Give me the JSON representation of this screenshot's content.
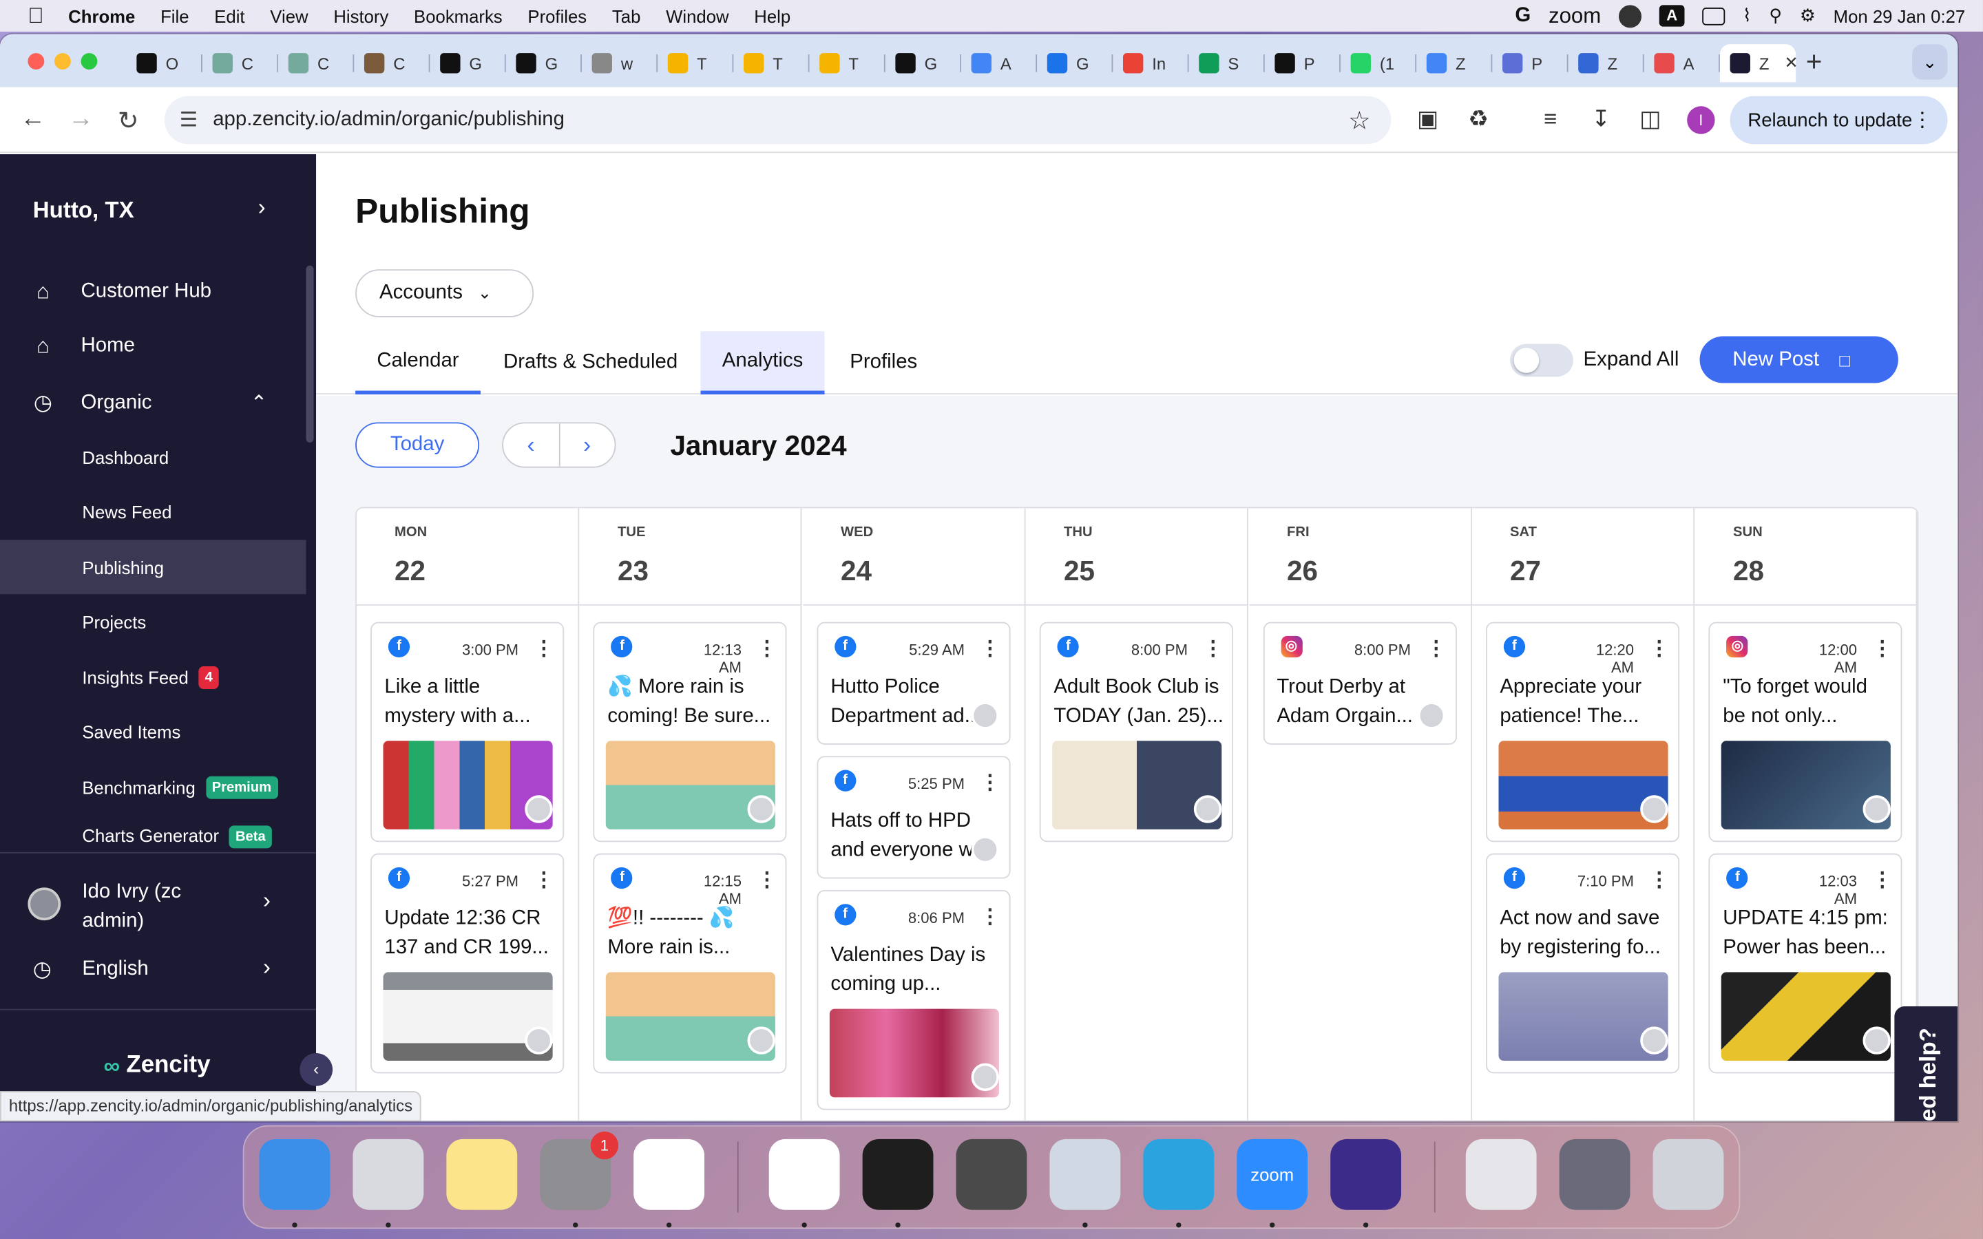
{
  "menubar": {
    "app": "Chrome",
    "items": [
      "File",
      "Edit",
      "View",
      "History",
      "Bookmarks",
      "Profiles",
      "Tab",
      "Window",
      "Help"
    ],
    "zoom_label": "zoom",
    "datetime": "Mon 29 Jan  0:27"
  },
  "browser": {
    "tabs": [
      {
        "letter": "O",
        "color": "#111"
      },
      {
        "letter": "C",
        "color": "#74aa9c"
      },
      {
        "letter": "C",
        "color": "#74aa9c"
      },
      {
        "letter": "C",
        "color": "#7a5a3a"
      },
      {
        "letter": "G",
        "color": "#111"
      },
      {
        "letter": "G",
        "color": "#111"
      },
      {
        "letter": "w",
        "color": "#888"
      },
      {
        "letter": "T",
        "color": "#f4b400"
      },
      {
        "letter": "T",
        "color": "#f4b400"
      },
      {
        "letter": "T",
        "color": "#f4b400"
      },
      {
        "letter": "G",
        "color": "#111"
      },
      {
        "letter": "A",
        "color": "#4285f4"
      },
      {
        "letter": "G",
        "color": "#1a73e8"
      },
      {
        "letter": "In",
        "color": "#ea4335"
      },
      {
        "letter": "S",
        "color": "#0f9d58"
      },
      {
        "letter": "P",
        "color": "#111"
      },
      {
        "letter": "(1",
        "color": "#25d366"
      },
      {
        "letter": "Z",
        "color": "#4285f4"
      },
      {
        "letter": "P",
        "color": "#5b6fd6"
      },
      {
        "letter": "Z",
        "color": "#3367d6"
      },
      {
        "letter": "A",
        "color": "#e84b4b"
      },
      {
        "letter": "Z",
        "color": "#fff",
        "active": true
      }
    ],
    "close_glyph": "✕",
    "url": "app.zencity.io/admin/organic/publishing",
    "profile_letter": "I",
    "relaunch_label": "Relaunch to update",
    "status_url": "https://app.zencity.io/admin/organic/publishing/analytics"
  },
  "sidebar": {
    "city": "Hutto, TX",
    "items": [
      {
        "label": "Customer Hub",
        "icon": "house-icon"
      },
      {
        "label": "Home",
        "icon": "house-icon"
      },
      {
        "label": "Organic",
        "icon": "globe-icon"
      }
    ],
    "sub_items": [
      {
        "label": "Dashboard"
      },
      {
        "label": "News Feed"
      },
      {
        "label": "Publishing",
        "selected": true
      },
      {
        "label": "Projects"
      },
      {
        "label": "Insights Feed",
        "badge": "4",
        "badge_color": "#e5293d"
      },
      {
        "label": "Saved Items"
      },
      {
        "label": "Benchmarking",
        "badge": "Premium",
        "badge_color": "#1fa67a"
      },
      {
        "label": "Charts Generator",
        "badge": "Beta",
        "badge_color": "#1fa67a"
      }
    ],
    "user": "Ido Ivry (zc admin)",
    "language": "English",
    "logo": "Zencity"
  },
  "main": {
    "title": "Publishing",
    "accounts_label": "Accounts",
    "tabs": [
      "Calendar",
      "Drafts & Scheduled",
      "Analytics",
      "Profiles"
    ],
    "expand_all": "Expand All",
    "new_post": "New Post",
    "today": "Today",
    "month": "January 2024",
    "days": [
      {
        "dow": "MON",
        "num": "22",
        "posts": [
          {
            "net": "fb",
            "time": "3:00 PM",
            "text": "Like a little mystery with a...",
            "img": "books"
          },
          {
            "net": "fb",
            "time": "5:27 PM",
            "text": "Update 12:36 CR 137 and CR 199...",
            "img": "road"
          }
        ]
      },
      {
        "dow": "TUE",
        "num": "23",
        "posts": [
          {
            "net": "fb",
            "time": "12:13 AM",
            "text": "💦 More rain is coming! Be sure...",
            "img": "rain"
          },
          {
            "net": "fb",
            "time": "12:15 AM",
            "text": "💯!! -------- 💦 More rain is...",
            "img": "rain"
          }
        ]
      },
      {
        "dow": "WED",
        "num": "24",
        "posts": [
          {
            "net": "fb",
            "time": "5:29 AM",
            "text": "Hutto Police Department ad...",
            "img": ""
          },
          {
            "net": "fb",
            "time": "5:25 PM",
            "text": "Hats off to HPD and everyone w...",
            "img": ""
          },
          {
            "net": "fb",
            "time": "8:06 PM",
            "text": "Valentines Day is coming up...",
            "img": "gifts"
          }
        ]
      },
      {
        "dow": "THU",
        "num": "25",
        "posts": [
          {
            "net": "fb",
            "time": "8:00 PM",
            "text": "Adult Book Club is TODAY (Jan. 25)...",
            "img": "bookclub"
          }
        ]
      },
      {
        "dow": "FRI",
        "num": "26",
        "posts": [
          {
            "net": "ig",
            "time": "8:00 PM",
            "text": "Trout Derby at Adam Orgain...",
            "img": ""
          }
        ]
      },
      {
        "dow": "SAT",
        "num": "27",
        "posts": [
          {
            "net": "fb",
            "time": "12:20 AM",
            "text": "Appreciate your patience! The...",
            "img": "tennis"
          },
          {
            "net": "fb",
            "time": "7:10 PM",
            "text": "Act now and save by registering fo...",
            "img": "hippo"
          }
        ]
      },
      {
        "dow": "SUN",
        "num": "28",
        "posts": [
          {
            "net": "ig",
            "time": "12:00 AM",
            "text": "\"To forget would be not only...",
            "img": "run"
          },
          {
            "net": "fb",
            "time": "12:03 AM",
            "text": "UPDATE 4:15 pm: Power has been...",
            "img": "traffic"
          }
        ]
      }
    ],
    "need_help": "Need help?"
  },
  "dock": {
    "apps": [
      {
        "name": "finder-icon",
        "color": "#3b8fe8"
      },
      {
        "name": "launchpad-icon",
        "color": "#d9d9e0"
      },
      {
        "name": "notes-icon",
        "color": "#fbe48a"
      },
      {
        "name": "system-settings-icon",
        "color": "#8e8e93",
        "badge": "1"
      },
      {
        "name": "slack-icon",
        "color": "#ffffff"
      },
      {
        "name": "chrome-icon",
        "color": "#ffffff"
      },
      {
        "name": "terminal-icon",
        "color": "#1e1e1e"
      },
      {
        "name": "sublime-icon",
        "color": "#4a4a4a"
      },
      {
        "name": "preview-icon",
        "color": "#cfd8e3"
      },
      {
        "name": "telegram-icon",
        "color": "#2aa3df"
      },
      {
        "name": "zoom-icon",
        "color": "#2d8cff"
      },
      {
        "name": "grammarly-icon",
        "color": "#3d2b8a"
      },
      {
        "name": "disk-utility-icon",
        "color": "#e5e5ea"
      },
      {
        "name": "window-thumbnail-icon",
        "color": "#6a6a7a"
      },
      {
        "name": "trash-icon",
        "color": "#d0d4da"
      }
    ],
    "zoom_label": "zoom"
  }
}
